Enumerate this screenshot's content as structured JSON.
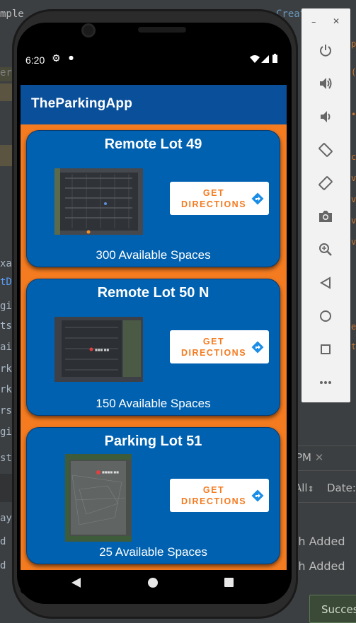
{
  "ide": {
    "left_fragments": [
      "mple",
      "er",
      "xa",
      "tD",
      "gi",
      "ts.",
      "air",
      "rk",
      "rk",
      "rs",
      "gi",
      "sts",
      "ay",
      "d",
      "d"
    ],
    "right_panel": {
      "tab": "PM",
      "filter": "All",
      "filter_icon": "up-down-arrow",
      "date_label": "Date:",
      "rows": [
        "sh  Added",
        "sh  Added"
      ]
    },
    "toast": "Succes",
    "top_fragment": "Creat"
  },
  "phone": {
    "status_time": "6:20",
    "app_title": "TheParkingApp",
    "cards": [
      {
        "title": "Remote Lot 49",
        "spaces": "300 Available Spaces",
        "button": "GET DIRECTIONS"
      },
      {
        "title": "Remote Lot 50 N",
        "spaces": "150 Available Spaces",
        "button": "GET DIRECTIONS"
      },
      {
        "title": "Parking Lot 51",
        "spaces": "25 Available Spaces",
        "button": "GET DIRECTIONS"
      }
    ]
  },
  "emulator_toolbar": {
    "window_controls": [
      "minimize",
      "close"
    ],
    "buttons": [
      "power-icon",
      "volume-up-icon",
      "volume-down-icon",
      "rotate-left-icon",
      "rotate-right-icon",
      "camera-icon",
      "zoom-icon",
      "back-icon",
      "home-icon",
      "overview-icon",
      "more-icon"
    ]
  },
  "colors": {
    "accent": "#f47b20",
    "card": "#0061b0",
    "appbar": "#0a4f99"
  }
}
